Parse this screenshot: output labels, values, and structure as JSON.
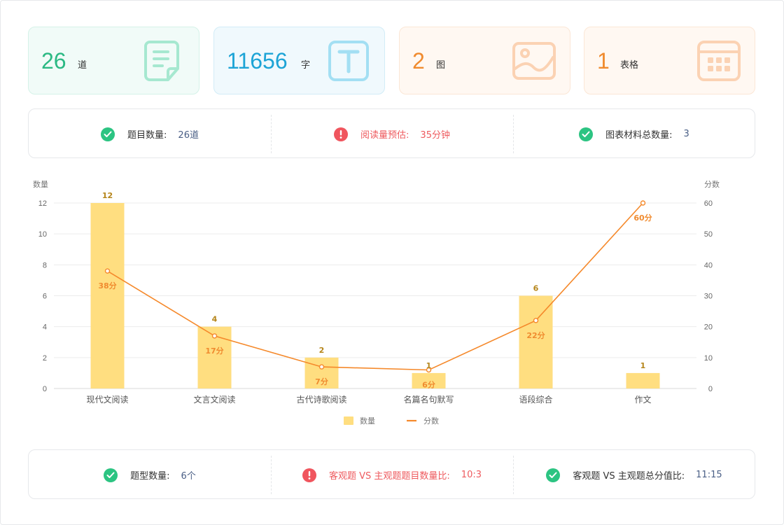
{
  "stats": [
    {
      "value": "26",
      "unit": "道",
      "icon": "document-icon",
      "color": "#2cb984"
    },
    {
      "value": "11656",
      "unit": "字",
      "icon": "text-icon",
      "color": "#1da4d6"
    },
    {
      "value": "2",
      "unit": "图",
      "icon": "image-icon",
      "color": "#f08b2f"
    },
    {
      "value": "1",
      "unit": "表格",
      "icon": "table-icon",
      "color": "#f08b2f"
    }
  ],
  "summary1": [
    {
      "status": "ok",
      "label": "题目数量:",
      "value": "26道"
    },
    {
      "status": "warn",
      "label": "阅读量预估:",
      "value": "35分钟"
    },
    {
      "status": "ok",
      "label": "图表材料总数量:",
      "value": "3"
    }
  ],
  "summary2": [
    {
      "status": "ok",
      "label": "题型数量:",
      "value": "6个"
    },
    {
      "status": "warn",
      "label": "客观题 VS 主观题题目数量比:",
      "value": "10:3"
    },
    {
      "status": "ok",
      "label": "客观题 VS 主观题总分值比:",
      "value": "11:15"
    }
  ],
  "chart_data": {
    "type": "bar+line",
    "categories": [
      "现代文阅读",
      "文言文阅读",
      "古代诗歌阅读",
      "名篇名句默写",
      "语段综合",
      "作文"
    ],
    "series": [
      {
        "name": "数量",
        "type": "bar",
        "axis": "left",
        "values": [
          12,
          4,
          2,
          1,
          6,
          1
        ],
        "labels": [
          "12",
          "4",
          "2",
          "1",
          "6",
          "1"
        ],
        "color": "#ffde80"
      },
      {
        "name": "分数",
        "type": "line",
        "axis": "right",
        "values": [
          38,
          17,
          7,
          6,
          22,
          60
        ],
        "labels": [
          "38分",
          "17分",
          "7分",
          "6分",
          "22分",
          "60分"
        ],
        "color": "#f5892b"
      }
    ],
    "ylabel_left": "数量",
    "ylabel_right": "分数",
    "ylim_left": [
      0,
      12
    ],
    "yticks_left": [
      "0",
      "2",
      "4",
      "6",
      "8",
      "10",
      "12"
    ],
    "ylim_right": [
      0,
      60
    ],
    "yticks_right": [
      "0",
      "10",
      "20",
      "30",
      "40",
      "50",
      "60"
    ],
    "grid": true,
    "legend_position": "bottom-center"
  }
}
